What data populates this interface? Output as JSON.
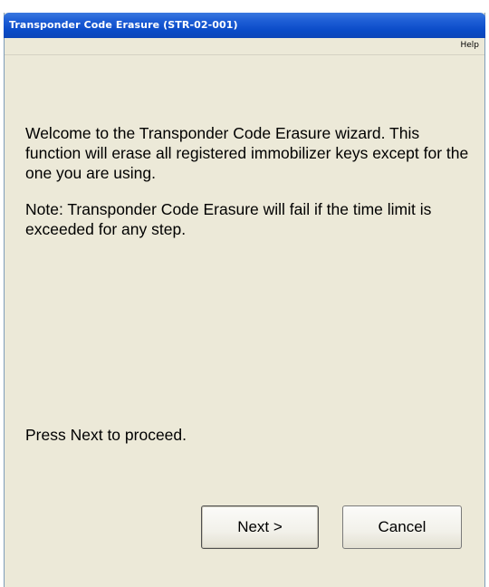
{
  "window": {
    "title": "Transponder Code Erasure (STR-02-001)"
  },
  "menu": {
    "help": "Help"
  },
  "body": {
    "welcome_text": "Welcome to the Transponder Code Erasure wizard. This function will erase all registered immobilizer keys except for the one you are using.",
    "note_text": "Note: Transponder Code Erasure will fail if the time limit is exceeded for any step.",
    "proceed_text": "Press Next to proceed."
  },
  "buttons": {
    "next": "Next >",
    "cancel": "Cancel"
  }
}
